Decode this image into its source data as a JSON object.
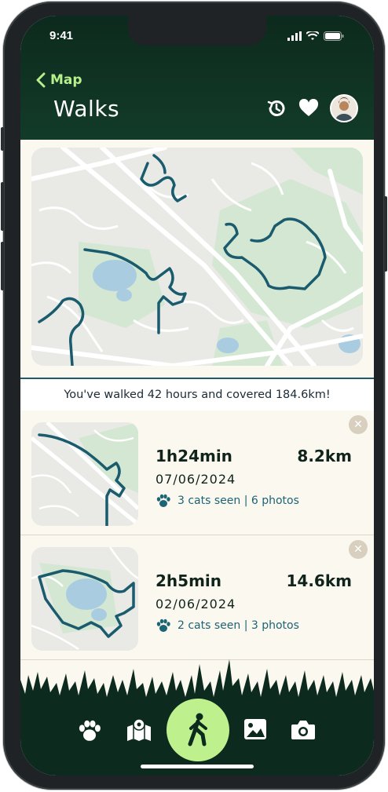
{
  "status": {
    "time": "9:41"
  },
  "header": {
    "back_label": "Map",
    "title": "Walks"
  },
  "summary": {
    "text": "You've walked 42 hours and covered 184.6km!"
  },
  "walks": [
    {
      "duration": "1h24min",
      "distance": "8.2km",
      "date": "07/06/2024",
      "meta": "3 cats seen | 6 photos"
    },
    {
      "duration": "2h5min",
      "distance": "14.6km",
      "date": "02/06/2024",
      "meta": "2 cats seen | 3 photos"
    }
  ],
  "icons": {
    "back": "chevron-left-icon",
    "history": "history-icon",
    "favorite": "heart-icon",
    "paw": "paw-icon",
    "map": "map-icon",
    "walk": "walking-person-icon",
    "gallery": "image-icon",
    "camera": "camera-icon",
    "close": "close-icon"
  },
  "colors": {
    "header_bg": "#0f3323",
    "accent_green": "#bff08e",
    "route": "#1a5b6d",
    "card_bg": "#fbf8f0",
    "text_teal": "#1d6475"
  }
}
